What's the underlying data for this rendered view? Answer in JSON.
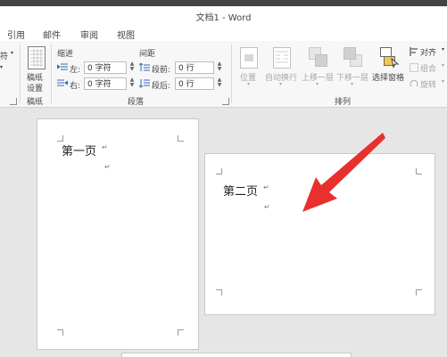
{
  "window": {
    "title": "文档1 - Word"
  },
  "tabs": [
    "引用",
    "邮件",
    "审阅",
    "视图"
  ],
  "ribbon": {
    "left_partial": "符",
    "paper_group": {
      "button_label_1": "稿纸",
      "button_label_2": "设置",
      "group_label": "稿纸"
    },
    "paragraph_group": {
      "indent_label": "缩进",
      "spacing_label": "间距",
      "left_label": "左:",
      "right_label": "右:",
      "left_value": "0 字符",
      "right_value": "0 字符",
      "before_label": "段前:",
      "after_label": "段后:",
      "before_value": "0 行",
      "after_value": "0 行",
      "group_label": "段落"
    },
    "arrange_group": {
      "position": "位置",
      "wrap_text": "自动换行",
      "bring_forward": "上移一层",
      "send_backward": "下移一层",
      "selection_pane": "选择窗格",
      "align": "对齐",
      "group": "组合",
      "rotate": "旋转",
      "group_label": "排列"
    }
  },
  "document": {
    "page1_text": "第一页",
    "page2_text": "第二页",
    "return_mark": "↵"
  },
  "colors": {
    "arrow": "#e8312f",
    "page_bg": "#ffffff",
    "canvas_bg": "#e6e6e6"
  }
}
